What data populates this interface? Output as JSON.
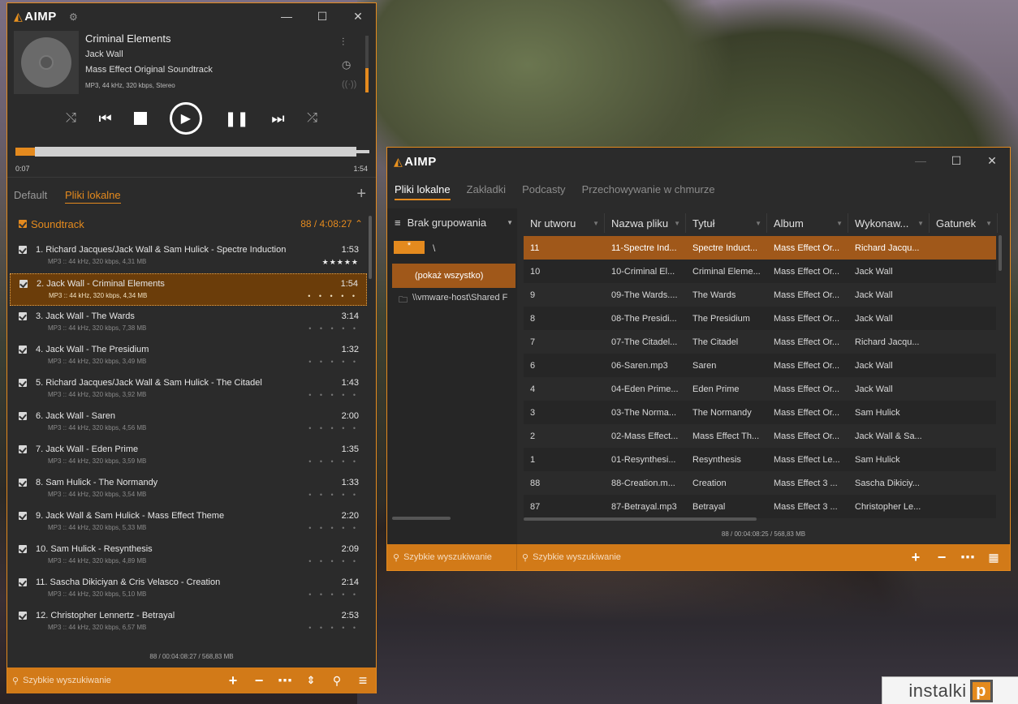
{
  "player": {
    "logo": "AIMP",
    "now_playing": {
      "title": "Criminal Elements",
      "artist": "Jack Wall",
      "album": "Mass Effect Original Soundtrack",
      "format": "MP3, 44 kHz, 320 kbps, Stereo"
    },
    "time_elapsed": "0:07",
    "time_total": "1:54",
    "tabs": [
      "Default",
      "Pliki lokalne"
    ],
    "group_title": "Soundtrack",
    "group_summary": "88 / 4:08:27",
    "tracks": [
      {
        "title": "1. Richard Jacques/Jack Wall & Sam Hulick - Spectre Induction",
        "info": "MP3 :: 44 kHz, 320 kbps, 4,31 MB",
        "duration": "1:53",
        "rating": "★★★★★"
      },
      {
        "title": "2. Jack Wall - Criminal Elements",
        "info": "MP3 :: 44 kHz, 320 kbps, 4,34 MB",
        "duration": "1:54",
        "rating": "• • • • •"
      },
      {
        "title": "3. Jack Wall - The Wards",
        "info": "MP3 :: 44 kHz, 320 kbps, 7,38 MB",
        "duration": "3:14",
        "rating": "• • • • •"
      },
      {
        "title": "4. Jack Wall - The Presidium",
        "info": "MP3 :: 44 kHz, 320 kbps, 3,49 MB",
        "duration": "1:32",
        "rating": "• • • • •"
      },
      {
        "title": "5. Richard Jacques/Jack Wall & Sam Hulick - The Citadel",
        "info": "MP3 :: 44 kHz, 320 kbps, 3,92 MB",
        "duration": "1:43",
        "rating": "• • • • •"
      },
      {
        "title": "6. Jack Wall - Saren",
        "info": "MP3 :: 44 kHz, 320 kbps, 4,56 MB",
        "duration": "2:00",
        "rating": "• • • • •"
      },
      {
        "title": "7. Jack Wall - Eden Prime",
        "info": "MP3 :: 44 kHz, 320 kbps, 3,59 MB",
        "duration": "1:35",
        "rating": "• • • • •"
      },
      {
        "title": "8. Sam Hulick - The Normandy",
        "info": "MP3 :: 44 kHz, 320 kbps, 3,54 MB",
        "duration": "1:33",
        "rating": "• • • • •"
      },
      {
        "title": "9. Jack Wall & Sam Hulick - Mass Effect Theme",
        "info": "MP3 :: 44 kHz, 320 kbps, 5,33 MB",
        "duration": "2:20",
        "rating": "• • • • •"
      },
      {
        "title": "10. Sam Hulick - Resynthesis",
        "info": "MP3 :: 44 kHz, 320 kbps, 4,89 MB",
        "duration": "2:09",
        "rating": "• • • • •"
      },
      {
        "title": "11. Sascha Dikiciyan & Cris Velasco - Creation",
        "info": "MP3 :: 44 kHz, 320 kbps, 5,10 MB",
        "duration": "2:14",
        "rating": "• • • • •"
      },
      {
        "title": "12. Christopher Lennertz - Betrayal",
        "info": "MP3 :: 44 kHz, 320 kbps, 6,57 MB",
        "duration": "2:53",
        "rating": "• • • • •"
      }
    ],
    "status": "88 / 00:04:08:27 / 568,83 MB",
    "search_placeholder": "Szybkie wyszukiwanie"
  },
  "library": {
    "logo": "AIMP",
    "tabs": [
      "Pliki lokalne",
      "Zakładki",
      "Podcasty",
      "Przechowywanie w chmurze"
    ],
    "grouping_label": "Brak grupowania",
    "filter_star": "*",
    "filter_root": "\\",
    "show_all": "(pokaż wszystko)",
    "folder": "\\\\vmware-host\\Shared F",
    "columns": [
      "Nr utworu",
      "Nazwa pliku",
      "Tytuł",
      "Album",
      "Wykonaw...",
      "Gatunek"
    ],
    "rows": [
      [
        "11",
        "11-Spectre Ind...",
        "Spectre Induct...",
        "Mass Effect Or...",
        "Richard Jacqu..."
      ],
      [
        "10",
        "10-Criminal El...",
        "Criminal Eleme...",
        "Mass Effect Or...",
        "Jack Wall"
      ],
      [
        "9",
        "09-The Wards....",
        "The Wards",
        "Mass Effect Or...",
        "Jack Wall"
      ],
      [
        "8",
        "08-The Presidi...",
        "The Presidium",
        "Mass Effect Or...",
        "Jack Wall"
      ],
      [
        "7",
        "07-The Citadel...",
        "The Citadel",
        "Mass Effect Or...",
        "Richard Jacqu..."
      ],
      [
        "6",
        "06-Saren.mp3",
        "Saren",
        "Mass Effect Or...",
        "Jack Wall"
      ],
      [
        "4",
        "04-Eden Prime...",
        "Eden Prime",
        "Mass Effect Or...",
        "Jack Wall"
      ],
      [
        "3",
        "03-The Norma...",
        "The Normandy",
        "Mass Effect Or...",
        "Sam Hulick"
      ],
      [
        "2",
        "02-Mass Effect...",
        "Mass Effect Th...",
        "Mass Effect Or...",
        "Jack Wall & Sa..."
      ],
      [
        "1",
        "01-Resynthesi...",
        "Resynthesis",
        "Mass Effect Le...",
        "Sam Hulick"
      ],
      [
        "88",
        "88-Creation.m...",
        "Creation",
        "Mass Effect 3 ...",
        "Sascha Dikiciy..."
      ],
      [
        "87",
        "87-Betrayal.mp3",
        "Betrayal",
        "Mass Effect 3 ...",
        "Christopher Le..."
      ]
    ],
    "status": "88 / 00:04:08:25 / 568,83 MB",
    "search_left": "Szybkie wyszukiwanie",
    "search_right": "Szybkie wyszukiwanie"
  },
  "watermark": "instalki",
  "colors": {
    "accent": "#e48a1e",
    "bar": "#d27a18",
    "selected_row": "#a0581a",
    "window_bg": "#2b2b2b"
  }
}
